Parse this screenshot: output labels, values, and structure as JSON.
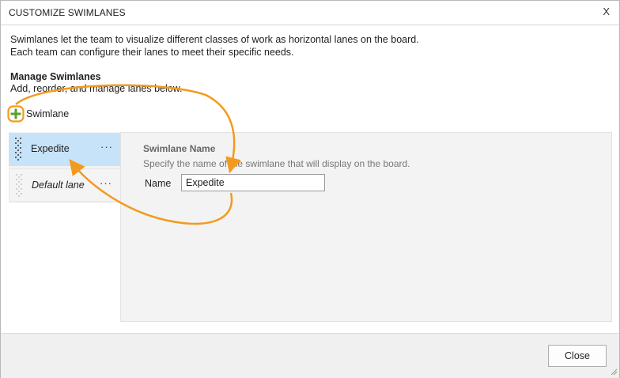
{
  "dialog": {
    "title": "CUSTOMIZE SWIMLANES",
    "close_glyph": "X",
    "description_line1": "Swimlanes let the team to visualize different classes of work as horizontal lanes on the board.",
    "description_line2": "Each team can configure their lanes to meet their specific needs.",
    "manage_heading": "Manage Swimlanes",
    "manage_subtext": "Add, reorder, and manage lanes below.",
    "add_button_label": "Swimlane",
    "add_button_icon": "plus-icon"
  },
  "lanes": [
    {
      "label": "Expedite",
      "selected": true,
      "more": "···"
    },
    {
      "label": "Default lane",
      "selected": false,
      "more": "···"
    }
  ],
  "detail": {
    "field_title": "Swimlane Name",
    "field_description": "Specify the name of the swimlane that will display on the board.",
    "name_label": "Name",
    "name_value": "Expedite"
  },
  "footer": {
    "close_label": "Close"
  },
  "colors": {
    "accent_orange": "#f39a1e",
    "plus_green": "#5aa02c",
    "selected_lane": "#c7e3fa"
  }
}
